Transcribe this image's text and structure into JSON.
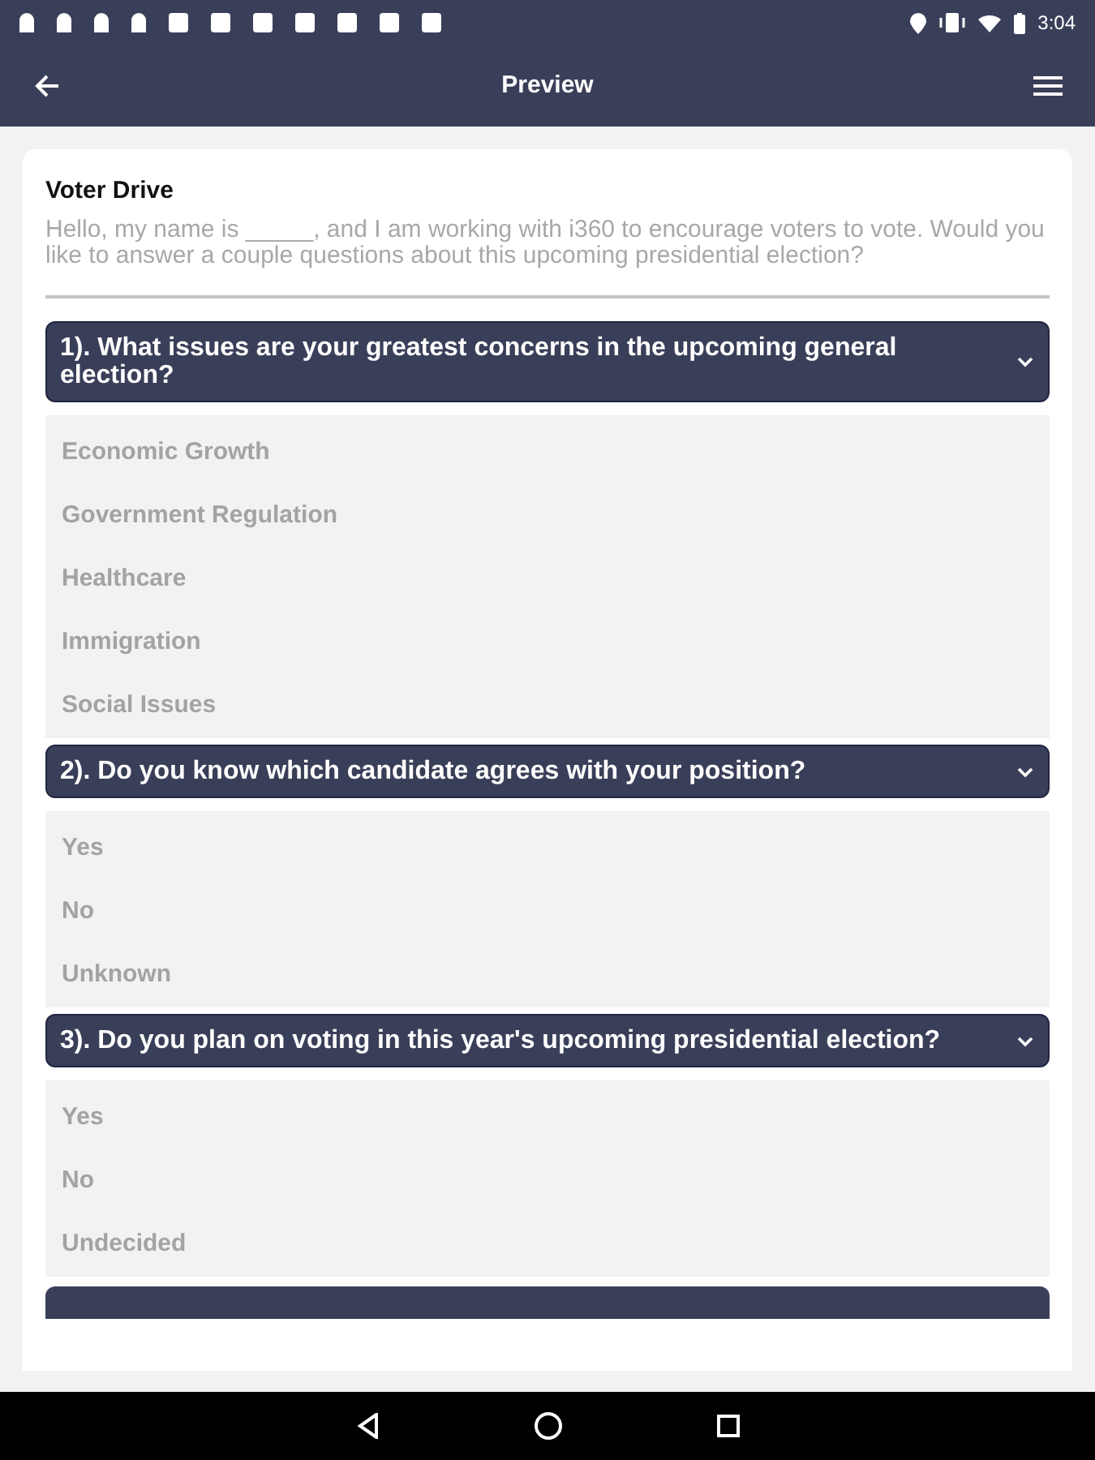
{
  "status_bar": {
    "time": "3:04"
  },
  "app_bar": {
    "title": "Preview"
  },
  "form": {
    "title": "Voter Drive",
    "intro": "Hello, my name is _____, and I am working with i360 to encourage voters to vote. Would you like to answer a couple questions about this upcoming presidential election?",
    "questions": [
      {
        "text": "1). What issues are your greatest concerns in the upcoming general election?",
        "options": [
          "Economic Growth",
          "Government Regulation",
          "Healthcare",
          "Immigration",
          "Social Issues"
        ]
      },
      {
        "text": "2). Do you know which candidate agrees with your position?",
        "options": [
          "Yes",
          "No",
          "Unknown"
        ]
      },
      {
        "text": "3). Do you plan on voting in this year's upcoming presidential election?",
        "options": [
          "Yes",
          "No",
          "Undecided"
        ]
      }
    ],
    "more_below": true
  }
}
